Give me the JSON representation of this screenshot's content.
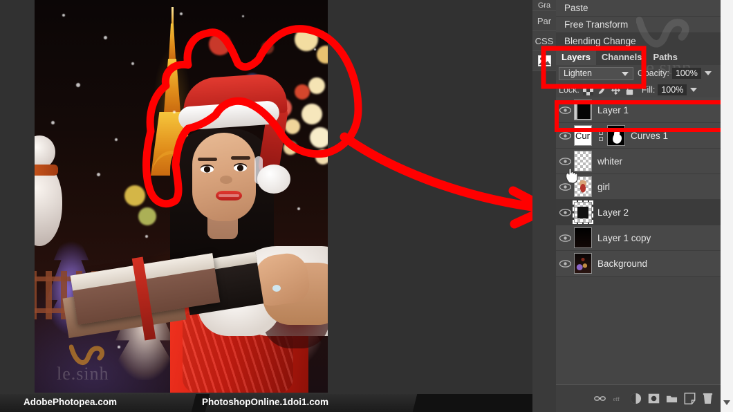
{
  "app": {
    "name": "Photopea",
    "watermark_canvas": "le.sinh",
    "watermark_panel": "le.sinh"
  },
  "toolbar_left": {
    "items": [
      {
        "label": "Gra",
        "name": "gradient-tool"
      },
      {
        "label": "Par",
        "name": "paragraph-tool"
      },
      {
        "label": "CSS",
        "name": "css-tool"
      },
      {
        "label": "",
        "name": "image-tool"
      }
    ]
  },
  "context_menu": {
    "items": [
      {
        "label": "Paste",
        "name": "menu-item-paste",
        "active": false
      },
      {
        "label": "Free Transform",
        "name": "menu-item-free-transform",
        "active": false
      },
      {
        "label": "Blending Change",
        "name": "menu-item-blending-change",
        "active": true
      }
    ]
  },
  "panel": {
    "tabs": [
      {
        "label": "Layers",
        "selected": true
      },
      {
        "label": "Channels",
        "selected": false
      },
      {
        "label": "Paths",
        "selected": false
      }
    ],
    "blend_mode": "Lighten",
    "opacity_label": "Opacity:",
    "opacity_value": "100%",
    "fill_label": "Fill:",
    "fill_value": "100%",
    "lock_label": "Lock:",
    "lock_icons": [
      "transparency-lock-icon",
      "brush-lock-icon",
      "move-lock-icon",
      "all-lock-icon"
    ],
    "footer_icons": [
      "link-layers-icon",
      "layer-effects-icon",
      "adjustment-layer-icon",
      "layer-mask-icon",
      "new-group-icon",
      "new-layer-icon",
      "delete-layer-icon"
    ]
  },
  "layers": [
    {
      "name": "Layer 1",
      "visible": true,
      "selected": false,
      "thumb": "stars",
      "kind": "raster"
    },
    {
      "name": "Curves 1",
      "visible": true,
      "selected": false,
      "thumb": "curves",
      "kind": "adjustment",
      "mask": true
    },
    {
      "name": "whiter",
      "visible": true,
      "selected": false,
      "thumb": "empty",
      "kind": "raster"
    },
    {
      "name": "girl",
      "visible": true,
      "selected": false,
      "thumb": "girl",
      "kind": "raster"
    },
    {
      "name": "Layer 2",
      "visible": true,
      "selected": true,
      "thumb": "selection",
      "kind": "raster"
    },
    {
      "name": "Layer 1 copy",
      "visible": true,
      "selected": false,
      "thumb": "dark",
      "kind": "raster"
    },
    {
      "name": "Background",
      "visible": true,
      "selected": false,
      "thumb": "photo",
      "kind": "raster"
    }
  ],
  "annotations": {
    "highlight_color": "#ff0000",
    "shapes": [
      "canvas-freeform-circle",
      "arrow-to-layer-2",
      "blend-mode-box",
      "layer-2-box"
    ]
  },
  "bottom_bar": {
    "left_label": "AdobePhotopea.com",
    "right_label": "PhotoshopOnline.1doi1.com"
  },
  "chart_data": null
}
